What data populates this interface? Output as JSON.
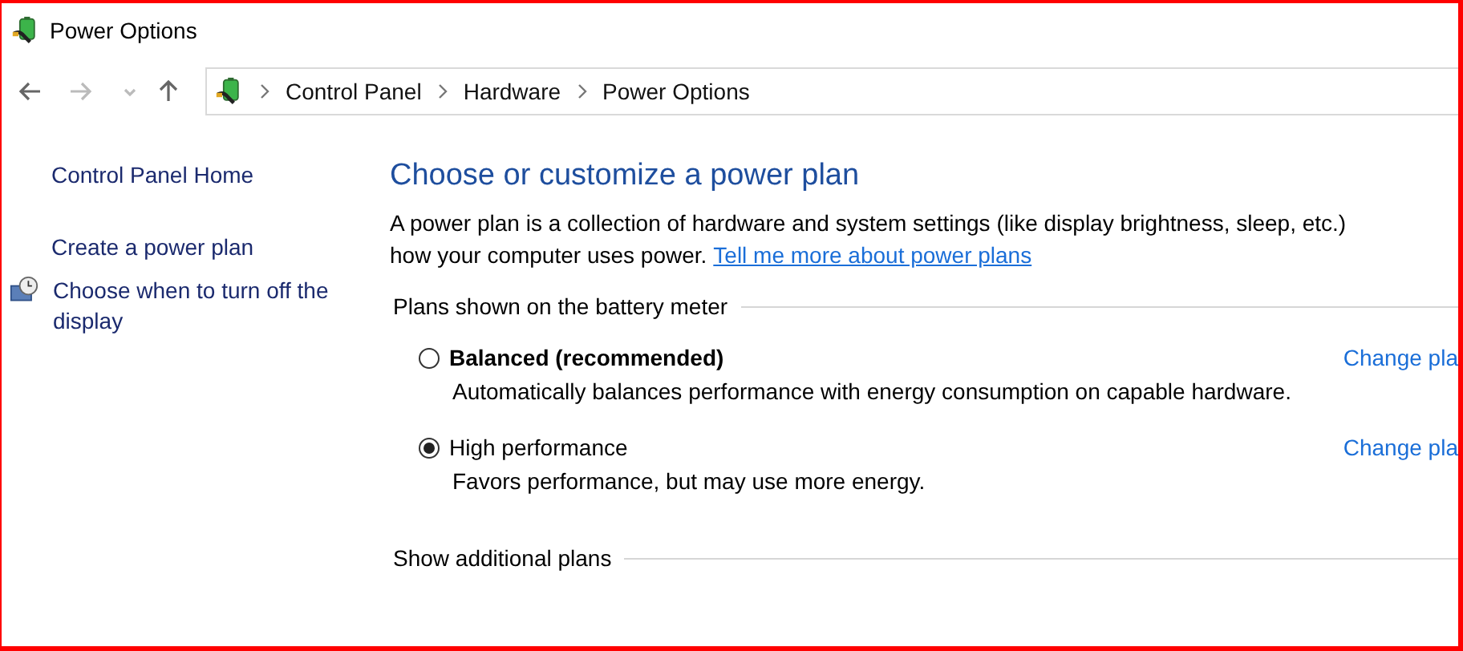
{
  "window": {
    "title": "Power Options"
  },
  "address_bar": {
    "breadcrumbs": [
      "Control Panel",
      "Hardware",
      "Power Options"
    ]
  },
  "sidebar": {
    "items": [
      {
        "label": "Control Panel Home",
        "kind": "home"
      },
      {
        "label": "Create a power plan",
        "kind": "link"
      },
      {
        "label": "Choose when to turn off the display",
        "kind": "task"
      }
    ]
  },
  "main": {
    "heading": "Choose or customize a power plan",
    "description": "A power plan is a collection of hardware and system settings (like display brightness, sleep, etc.)",
    "description_2": "how your computer uses power.",
    "link": "Tell me more about power plans",
    "plans_group": "Plans shown on the battery meter",
    "plans": [
      {
        "name": "Balanced (recommended)",
        "bold": true,
        "selected": false,
        "description": "Automatically balances performance with energy consumption on capable hardware.",
        "change_link": "Change pla"
      },
      {
        "name": "High performance",
        "bold": false,
        "selected": true,
        "description": "Favors performance, but may use more energy.",
        "change_link": "Change pla"
      }
    ],
    "additional_plans": "Show additional plans"
  }
}
